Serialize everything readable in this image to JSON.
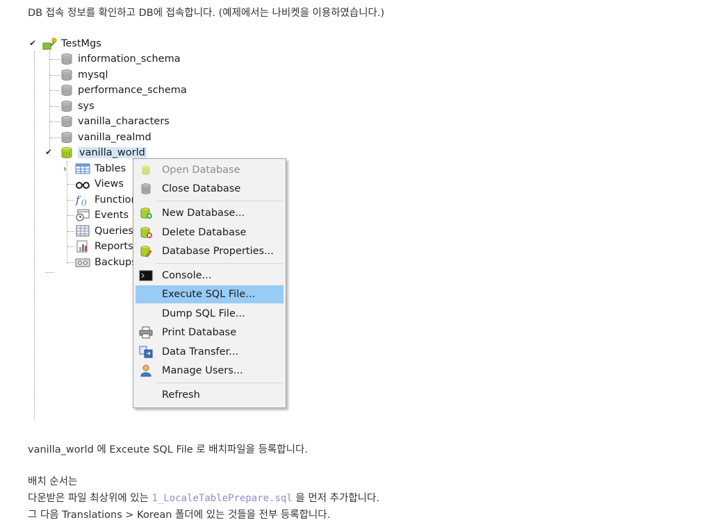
{
  "intro": "DB 접속 정보를 확인하고 DB에 접속합니다. (예제에서는 나비켓을 이용하였습니다.)",
  "tree": {
    "connection": "TestMgs",
    "databases": [
      "information_schema",
      "mysql",
      "performance_schema",
      "sys",
      "vanilla_characters",
      "vanilla_realmd",
      "vanilla_world"
    ],
    "children": [
      "Tables",
      "Views",
      "Functions",
      "Events",
      "Queries",
      "Reports",
      "Backups"
    ]
  },
  "menu": {
    "open_database": "Open Database",
    "close_database": "Close Database",
    "new_database": "New Database...",
    "delete_database": "Delete Database",
    "database_properties": "Database Properties...",
    "console": "Console...",
    "execute_sql_file": "Execute SQL File...",
    "dump_sql_file": "Dump SQL File...",
    "print_database": "Print Database",
    "data_transfer": "Data Transfer...",
    "manage_users": "Manage Users...",
    "refresh": "Refresh"
  },
  "body": {
    "line1": "vanilla_world 에 Exceute SQL File 로 배치파일을 등록합니다.",
    "line2": "배치 순서는",
    "line3_before": "다운받은 파일 최상위에 있는 ",
    "line3_code": "1_LocaleTablePrepare.sql",
    "line3_after": " 을 먼저 추가합니다.",
    "line4": "그 다음 Translations > Korean 폴더에 있는 것들을 전부 등록합니다."
  }
}
